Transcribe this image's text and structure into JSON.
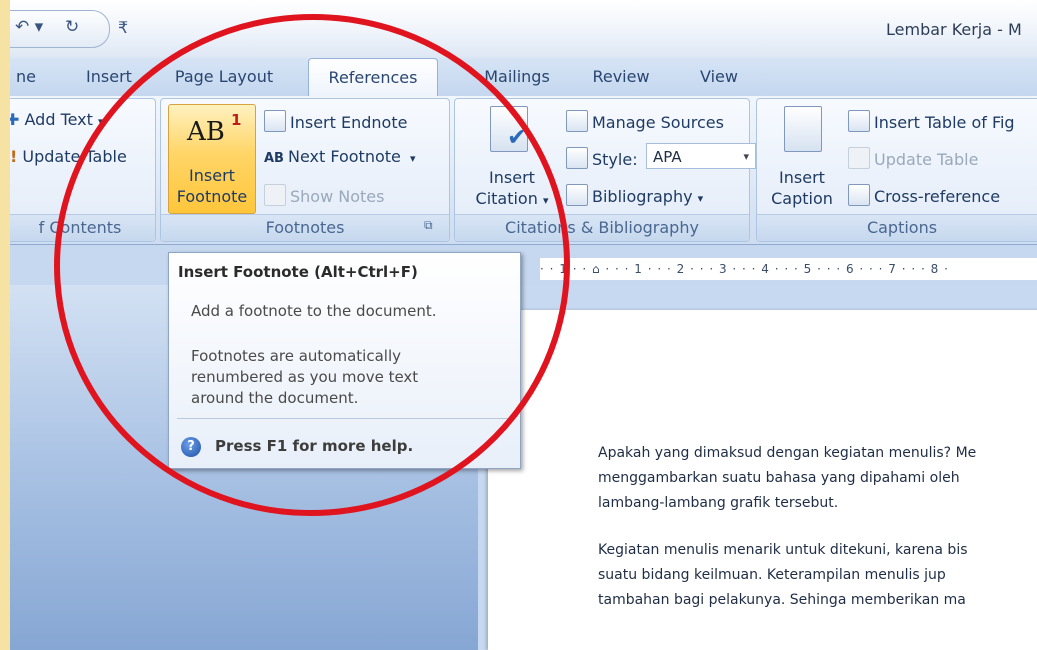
{
  "window": {
    "title": "Lembar Kerja - M",
    "qat": {
      "undo_glyph": "↶ ▾",
      "redo_glyph": "↻",
      "custom_glyph": "₹"
    }
  },
  "tabs": [
    {
      "label": "ne"
    },
    {
      "label": "Insert"
    },
    {
      "label": "Page Layout"
    },
    {
      "label": "References",
      "active": true
    },
    {
      "label": "Mailings"
    },
    {
      "label": "Review"
    },
    {
      "label": "View"
    }
  ],
  "ribbon": {
    "toc": {
      "add_text": "Add Text",
      "add_text_arrow": "▾",
      "update_table": "Update Table",
      "label": "f Contents"
    },
    "footnotes": {
      "insert_footnote_icon": "AB",
      "insert_footnote_sup": "1",
      "insert_footnote_line1": "Insert",
      "insert_footnote_line2": "Footnote",
      "insert_endnote": "Insert Endnote",
      "next_footnote": "Next Footnote",
      "next_footnote_arrow": "▾",
      "show_notes": "Show Notes",
      "label": "Footnotes",
      "launcher": "⧉"
    },
    "citations": {
      "insert_citation_line1": "Insert",
      "insert_citation_line2": "Citation",
      "insert_citation_arrow": "▾",
      "manage_sources": "Manage Sources",
      "style_label": "Style:",
      "style_value": "APA",
      "style_arrow": "▾",
      "bibliography": "Bibliography",
      "bibliography_arrow": "▾",
      "label": "Citations & Bibliography"
    },
    "captions": {
      "insert_caption_line1": "Insert",
      "insert_caption_line2": "Caption",
      "insert_table_of_figures": "Insert Table of Fig",
      "update_table": "Update Table",
      "cross_reference": "Cross-reference",
      "label": "Captions"
    }
  },
  "ruler": {
    "text": "· · 1 · · ⌂ · · · 1 · · · 2 · · · 3 · · · 4 · · · 5 · · · 6 · · · 7 · · · 8 ·"
  },
  "tooltip": {
    "title": "Insert Footnote (Alt+Ctrl+F)",
    "desc": "Add a footnote to the document.",
    "detail_lines": [
      "Footnotes are automatically",
      "renumbered as you move text",
      "around the document."
    ],
    "help_icon": "?",
    "help": "Press F1 for more help."
  },
  "document": {
    "lines": [
      "Apakah yang dimaksud dengan kegiatan menulis? Me",
      "menggambarkan suatu bahasa yang dipahami oleh",
      "lambang-lambang grafik tersebut.",
      "Kegiatan menulis menarik untuk ditekuni, karena bis",
      "suatu bidang keilmuan. Keterampilan menulis jup",
      "tambahan bagi pelakunya. Sehinga memberikan ma"
    ]
  },
  "colors": {
    "annotation_circle": "#e0141e",
    "ribbon_highlight": "#ffd567",
    "slide_background": "#f6e3a4"
  }
}
